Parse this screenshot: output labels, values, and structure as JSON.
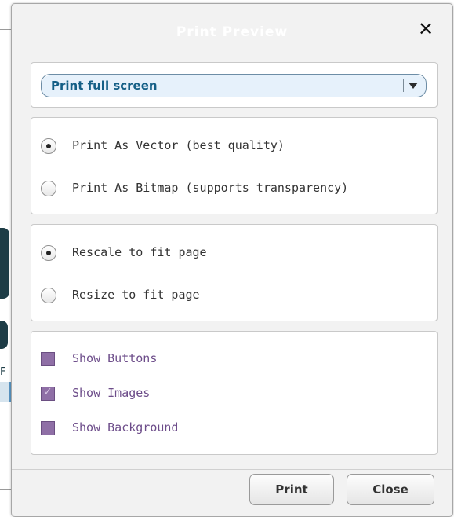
{
  "dialog": {
    "title": "Print Preview",
    "close_icon_glyph": "✕"
  },
  "print_scope": {
    "selected": "Print full screen"
  },
  "render_mode": {
    "options": [
      {
        "label": "Print As Vector (best quality)",
        "checked": true
      },
      {
        "label": "Print As Bitmap (supports transparency)",
        "checked": false
      }
    ]
  },
  "scaling": {
    "options": [
      {
        "label": "Rescale to fit page",
        "checked": true
      },
      {
        "label": "Resize to fit page",
        "checked": false
      }
    ]
  },
  "visibility": {
    "options": [
      {
        "label": "Show Buttons",
        "checked": false
      },
      {
        "label": "Show Images",
        "checked": true
      },
      {
        "label": "Show Background",
        "checked": false
      }
    ]
  },
  "footer": {
    "print_label": "Print",
    "close_label": "Close"
  },
  "background": {
    "partial_text": "F"
  },
  "colors": {
    "titlebar_text": "#ffffff",
    "dropdown_text": "#145f86",
    "checkbox_fill": "#8f6fa6",
    "checkbox_label": "#6d4d8a"
  }
}
